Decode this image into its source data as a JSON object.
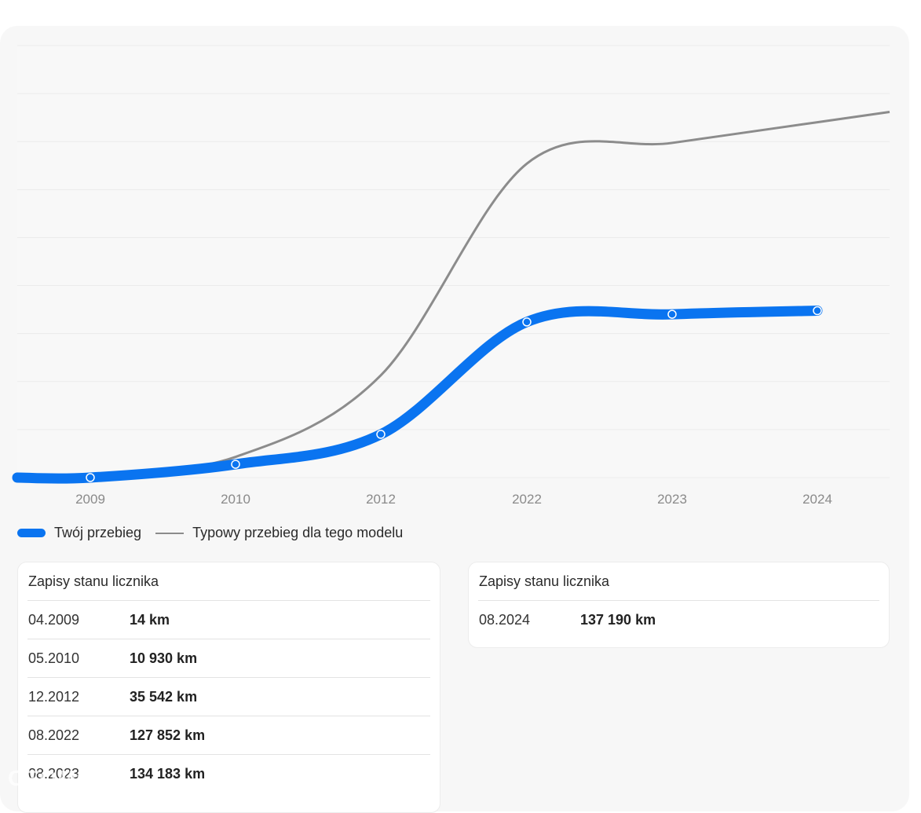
{
  "chart_data": {
    "type": "line",
    "categories": [
      "2009",
      "2010",
      "2012",
      "2022",
      "2023",
      "2024"
    ],
    "series": [
      {
        "name": "Twój przebieg",
        "color": "#0a74f0",
        "values": [
          14,
          10930,
          35542,
          127852,
          134183,
          137190
        ]
      },
      {
        "name": "Typowy przebieg dla tego modelu",
        "color": "#8c8c8c",
        "values": [
          0,
          17000,
          84000,
          258000,
          275000,
          292000
        ]
      }
    ],
    "ylim": [
      0,
      355000
    ],
    "grid": true,
    "legend": "bottom-left"
  },
  "legend": {
    "yours": "Twój przebieg",
    "typical": "Typowy przebieg dla tego modelu"
  },
  "records_left": {
    "title": "Zapisy stanu licznika",
    "rows": [
      {
        "date": "04.2009",
        "km": "14 km"
      },
      {
        "date": "05.2010",
        "km": "10 930 km"
      },
      {
        "date": "12.2012",
        "km": "35 542 km"
      },
      {
        "date": "08.2022",
        "km": "127 852 km"
      },
      {
        "date": "08.2023",
        "km": "134 183 km"
      }
    ]
  },
  "records_right": {
    "title": "Zapisy stanu licznika",
    "rows": [
      {
        "date": "08.2024",
        "km": "137 190 km"
      }
    ]
  },
  "watermark": "OTOMOTO"
}
